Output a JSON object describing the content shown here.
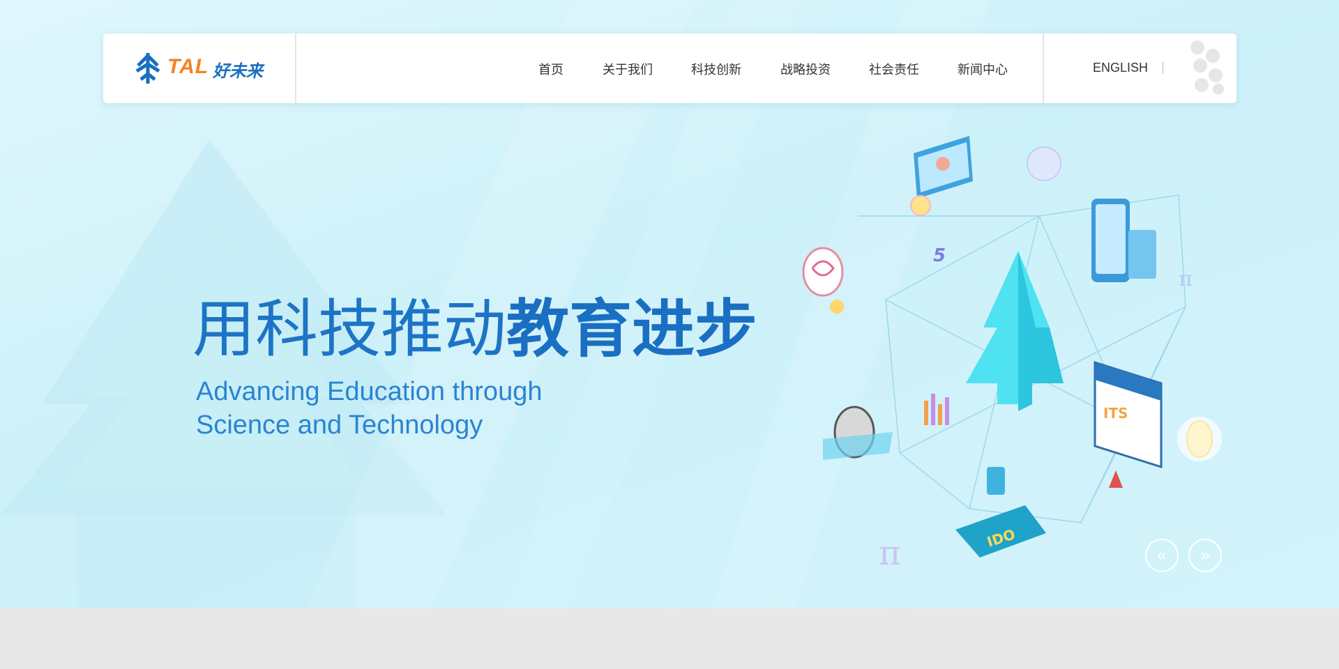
{
  "brand": {
    "logo_text": "TAL",
    "logo_cn": "好未来",
    "logo_color_orange": "#f5821f",
    "logo_color_blue": "#1a6fc0"
  },
  "nav": {
    "items": [
      {
        "label": "首页"
      },
      {
        "label": "关于我们"
      },
      {
        "label": "科技创新"
      },
      {
        "label": "战略投资"
      },
      {
        "label": "社会责任"
      },
      {
        "label": "新闻中心"
      }
    ],
    "language_label": "ENGLISH",
    "menu_icon": "dots-grid-icon"
  },
  "hero": {
    "headline_light": "用科技推动",
    "headline_bold": "教育进步",
    "subline_1": "Advancing Education through",
    "subline_2": "Science and Technology",
    "illustration_label_its": "ITS",
    "illustration_label_ido": "IDO",
    "illustration_label_five": "5",
    "accent_color": "#1d74c6",
    "background_color": "#d3f3fb"
  },
  "carousel": {
    "prev_label": "«",
    "next_label": "»"
  }
}
